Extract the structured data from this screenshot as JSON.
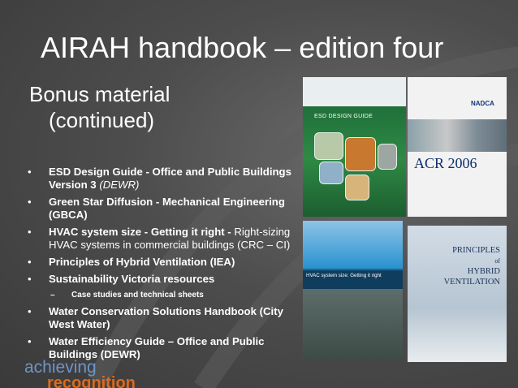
{
  "slide": {
    "title": "AIRAH handbook – edition four",
    "subtitle_line1": "Bonus material",
    "subtitle_line2": "(continued)"
  },
  "bullets": [
    {
      "bold": "ESD Design Guide - Office and Public Buildings Version 3",
      "italic": "(DEWR)"
    },
    {
      "bold": "Green Star Diffusion - Mechanical Engineering (GBCA)"
    },
    {
      "bold": "HVAC system size - Getting it right -",
      "normal": "Right-sizing HVAC systems in commercial buildings (CRC – CI)"
    },
    {
      "bold": "Principles of Hybrid Ventilation (IEA)"
    },
    {
      "bold": "Sustainability Victoria resources"
    },
    {
      "sub": "Case studies and technical sheets"
    },
    {
      "bold": "Water Conservation Solutions Handbook (City West Water)"
    },
    {
      "bold": "Water Efficiency Guide – Office and Public Buildings (DEWR)"
    }
  ],
  "covers": {
    "esd": {
      "title": "ESD DESIGN GUIDE"
    },
    "acr": {
      "logo": "NADCA",
      "title": "ACR 2006"
    },
    "hvac": {
      "title": "HVAC system size: Getting it right"
    },
    "hybrid": {
      "line1": "PRINCIPLES",
      "line2": "of",
      "line3": "HYBRID",
      "line4": "VENTILATION"
    }
  },
  "footer": {
    "line1": "achieving",
    "line2": "recognition"
  },
  "colors": {
    "background": "#4d4d4d",
    "footer_blue": "#6d95c8",
    "footer_orange": "#e06a17"
  }
}
